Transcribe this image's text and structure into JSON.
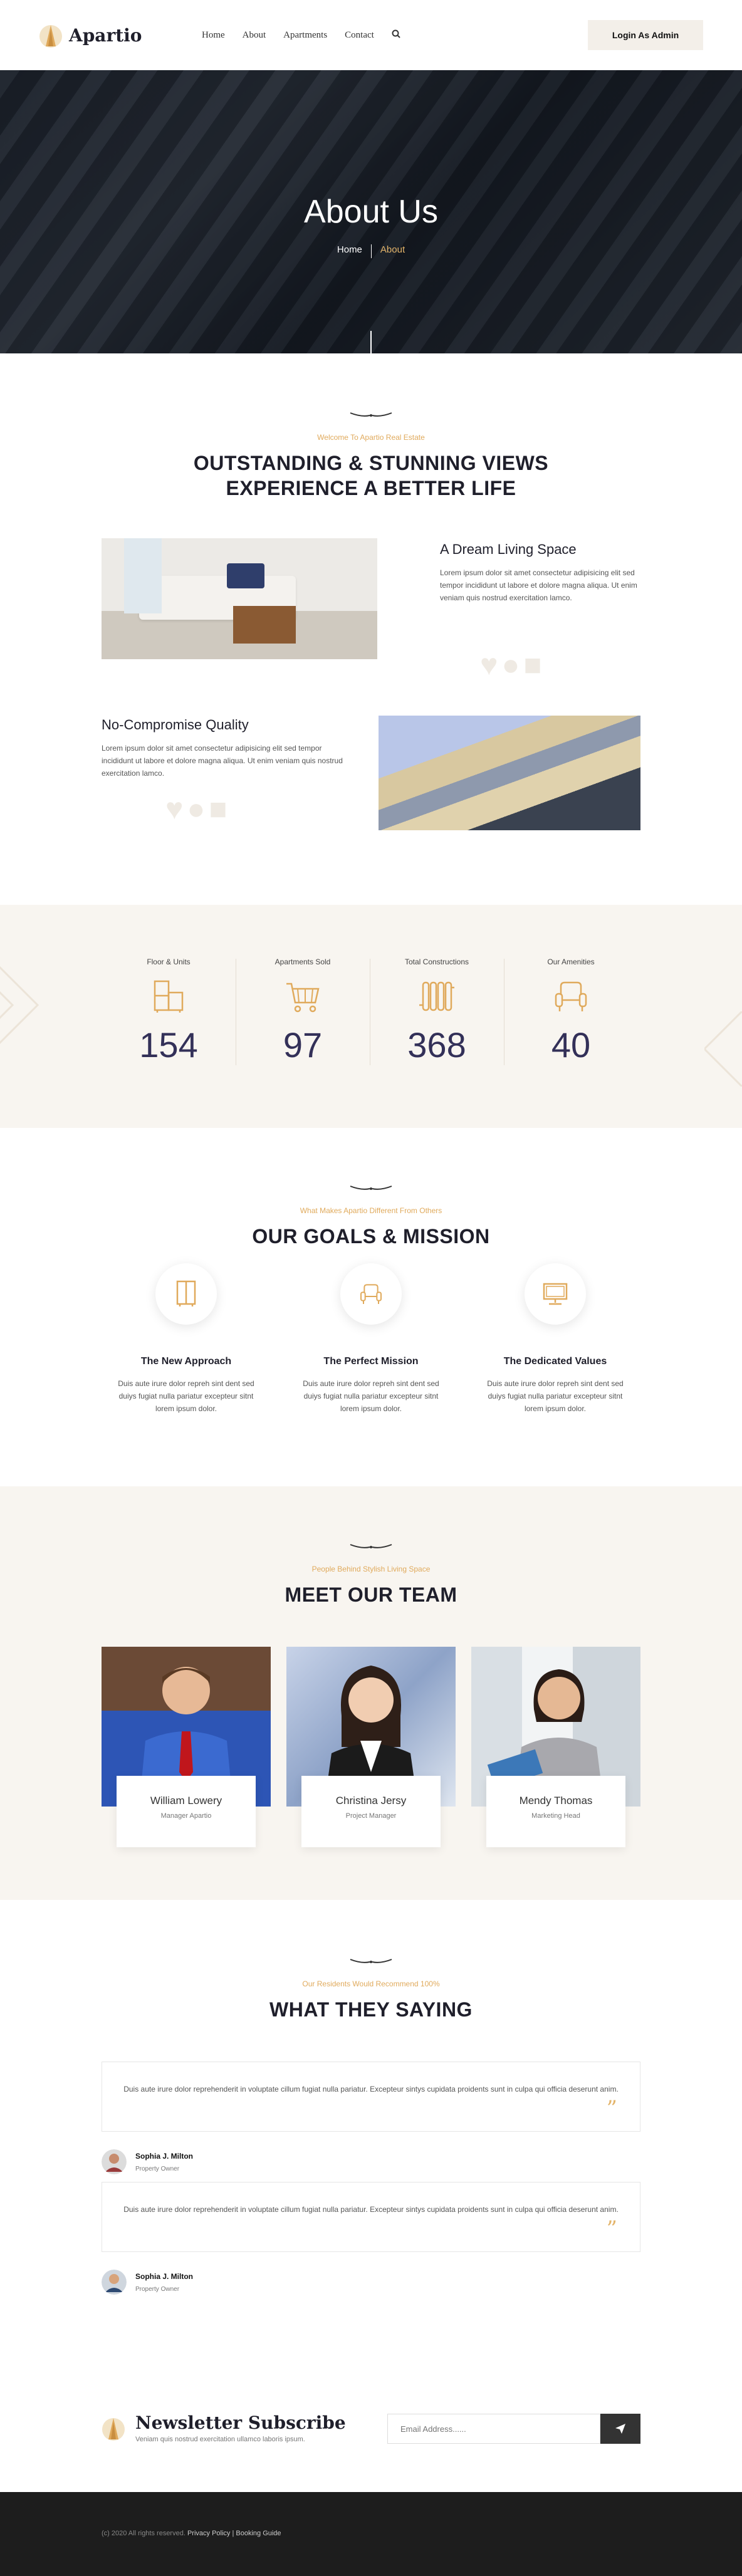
{
  "header": {
    "brand": "Apartio",
    "nav": [
      "Home",
      "About",
      "Apartments",
      "Contact"
    ],
    "admin_button": "Login As Admin"
  },
  "hero": {
    "title": "About Us",
    "crumb_home": "Home",
    "crumb_current": "About"
  },
  "about": {
    "kicker": "Welcome To Apartio Real Estate",
    "title_line1": "OUTSTANDING & STUNNING VIEWS",
    "title_line2": "EXPERIENCE A BETTER LIFE",
    "feature1": {
      "title": "A Dream Living Space",
      "text": "Lorem ipsum dolor sit amet consectetur adipisicing elit sed tempor incididunt ut labore et dolore magna aliqua. Ut enim veniam quis nostrud exercitation lamco."
    },
    "feature2": {
      "title": "No-Compromise Quality",
      "text": "Lorem ipsum dolor sit amet consectetur adipisicing elit sed tempor incididunt ut labore et dolore magna aliqua. Ut enim veniam quis nostrud exercitation lamco."
    }
  },
  "stats": [
    {
      "label": "Floor & Units",
      "value": "154",
      "icon": "cabinet-icon"
    },
    {
      "label": "Apartments Sold",
      "value": "97",
      "icon": "cart-icon"
    },
    {
      "label": "Total Constructions",
      "value": "368",
      "icon": "radiator-icon"
    },
    {
      "label": "Our Amenities",
      "value": "40",
      "icon": "armchair-icon"
    }
  ],
  "goals": {
    "kicker": "What Makes Apartio Different From Others",
    "title": "OUR GOALS & MISSION",
    "items": [
      {
        "title": "The New Approach",
        "text": "Duis aute irure dolor repreh sint dent sed duiys fugiat nulla pariatur excepteur sitnt lorem ipsum dolor.",
        "icon": "wardrobe-icon"
      },
      {
        "title": "The Perfect Mission",
        "text": "Duis aute irure dolor repreh sint dent sed duiys fugiat nulla pariatur excepteur sitnt lorem ipsum dolor.",
        "icon": "armchair-icon"
      },
      {
        "title": "The Dedicated Values",
        "text": "Duis aute irure dolor repreh sint dent sed duiys fugiat nulla pariatur excepteur sitnt lorem ipsum dolor.",
        "icon": "monitor-icon"
      }
    ]
  },
  "team": {
    "kicker": "People Behind Stylish Living Space",
    "title": "MEET OUR TEAM",
    "members": [
      {
        "name": "William Lowery",
        "role": "Manager Apartio"
      },
      {
        "name": "Christina Jersy",
        "role": "Project Manager"
      },
      {
        "name": "Mendy Thomas",
        "role": "Marketing Head"
      }
    ]
  },
  "testimonials": {
    "kicker": "Our Residents Would Recommend 100%",
    "title": "WHAT THEY SAYING",
    "items": [
      {
        "text": "Duis aute irure dolor reprehenderit in voluptate cillum fugiat nulla pariatur. Excepteur sintys cupidata proidents sunt in culpa qui officia deserunt anim.",
        "name": "Sophia J. Milton",
        "role": "Property Owner"
      },
      {
        "text": "Duis aute irure dolor reprehenderit in voluptate cillum fugiat nulla pariatur. Excepteur sintys cupidata proidents sunt in culpa qui officia deserunt anim.",
        "name": "Sophia J. Milton",
        "role": "Property Owner"
      }
    ]
  },
  "newsletter": {
    "title": "Newsletter Subscribe",
    "subtitle": "Veniam quis nostrud exercitation ullamco laboris ipsum.",
    "placeholder": "Email Address......"
  },
  "footer": {
    "copyright": "(c) 2020 All rights reserved.",
    "links": "Privacy Policy | Booking Guide"
  },
  "colors": {
    "accent": "#e3b46a",
    "dark": "#1f1f2b",
    "stat_number": "#333058"
  }
}
